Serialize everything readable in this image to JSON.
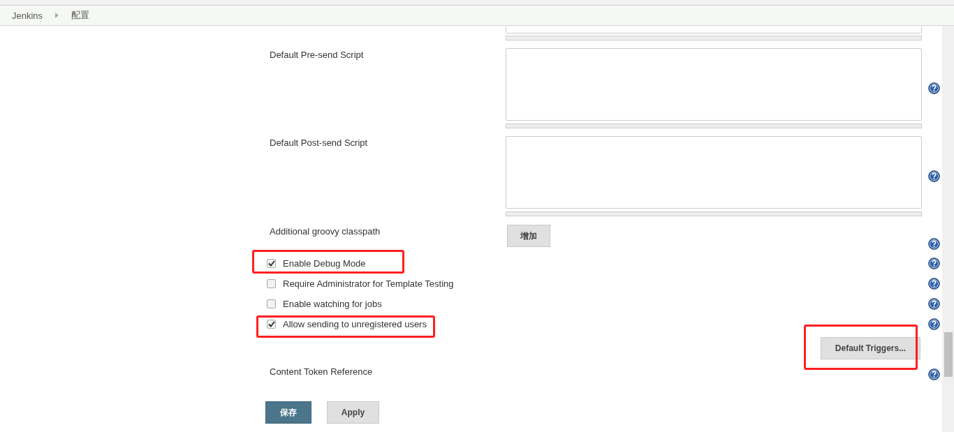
{
  "breadcrumb": [
    {
      "label": "Jenkins"
    },
    {
      "label": "配置"
    }
  ],
  "rows": [
    {
      "kind": "textarea",
      "help": false,
      "annotated": false
    },
    {
      "kind": "textarea",
      "label": "Default Pre-send Script",
      "help": true,
      "annotated": false
    },
    {
      "kind": "textarea",
      "label": "Default Post-send Script",
      "help": true,
      "annotated": false
    },
    {
      "kind": "add",
      "label": "Additional groovy classpath",
      "button": "增加",
      "help": true,
      "annotated": false
    },
    {
      "kind": "checkbox",
      "label": "Enable Debug Mode",
      "checked": true,
      "help": true,
      "annotated": true
    },
    {
      "kind": "checkbox",
      "label": "Require Administrator for Template Testing",
      "checked": false,
      "help": true,
      "annotated": false
    },
    {
      "kind": "checkbox",
      "label": "Enable watching for jobs",
      "checked": false,
      "help": true,
      "annotated": false
    },
    {
      "kind": "checkbox",
      "label": "Allow sending to unregistered users",
      "checked": true,
      "help": true,
      "annotated": true
    },
    {
      "kind": "right-button",
      "button": "Default Triggers...",
      "help": false,
      "annotated": true
    },
    {
      "kind": "text",
      "label": "Content Token Reference",
      "help": true,
      "annotated": false
    }
  ],
  "actions": [
    {
      "label": "保存",
      "kind": "primary"
    },
    {
      "label": "Apply",
      "kind": "secondary"
    }
  ]
}
